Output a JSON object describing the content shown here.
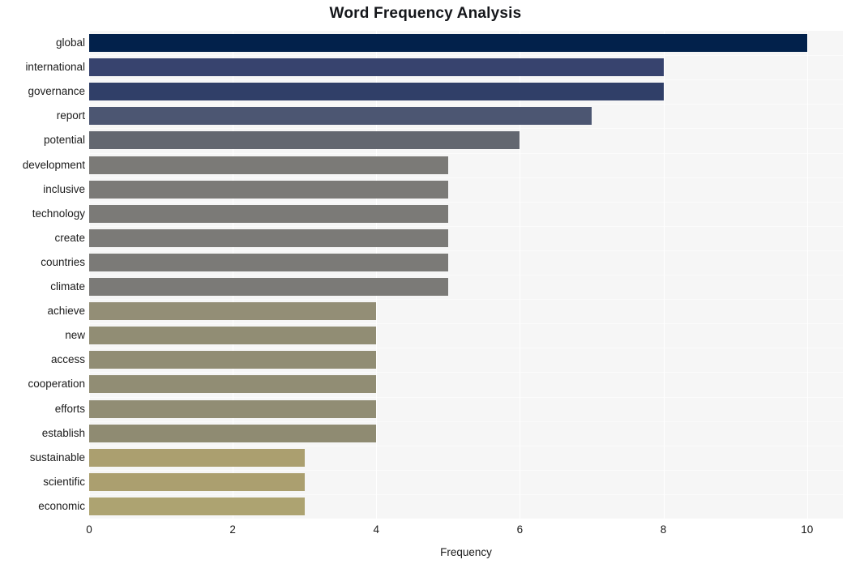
{
  "chart_data": {
    "type": "bar",
    "orientation": "horizontal",
    "title": "Word Frequency Analysis",
    "xlabel": "Frequency",
    "ylabel": "",
    "xlim": [
      0,
      10.5
    ],
    "xticks": [
      0,
      2,
      4,
      6,
      8,
      10
    ],
    "xtick_labels": [
      "0",
      "2",
      "4",
      "6",
      "8",
      "10"
    ],
    "grid": true,
    "grid_axis": "x",
    "legend": null,
    "categories": [
      "global",
      "international",
      "governance",
      "report",
      "potential",
      "development",
      "inclusive",
      "technology",
      "create",
      "countries",
      "climate",
      "achieve",
      "new",
      "access",
      "cooperation",
      "efforts",
      "establish",
      "sustainable",
      "scientific",
      "economic"
    ],
    "values": [
      10,
      8,
      8,
      7,
      6,
      5,
      5,
      5,
      5,
      5,
      5,
      4,
      4,
      4,
      4,
      4,
      4,
      3,
      3,
      3
    ],
    "bar_colors": [
      "#02214b",
      "#37436e",
      "#303f68",
      "#4c5672",
      "#636770",
      "#7b7a77",
      "#7b7a77",
      "#7b7a77",
      "#7b7a77",
      "#7b7a77",
      "#7b7a77",
      "#938e76",
      "#918d74",
      "#918d74",
      "#918d74",
      "#918d74",
      "#8f8b72",
      "#ab9f6f",
      "#ab9f6f",
      "#ada371"
    ],
    "plot_background": "#f6f6f6",
    "grid_color": "#ffffff",
    "figure_background": "#ffffff",
    "text_color": "#1b1b1b"
  }
}
